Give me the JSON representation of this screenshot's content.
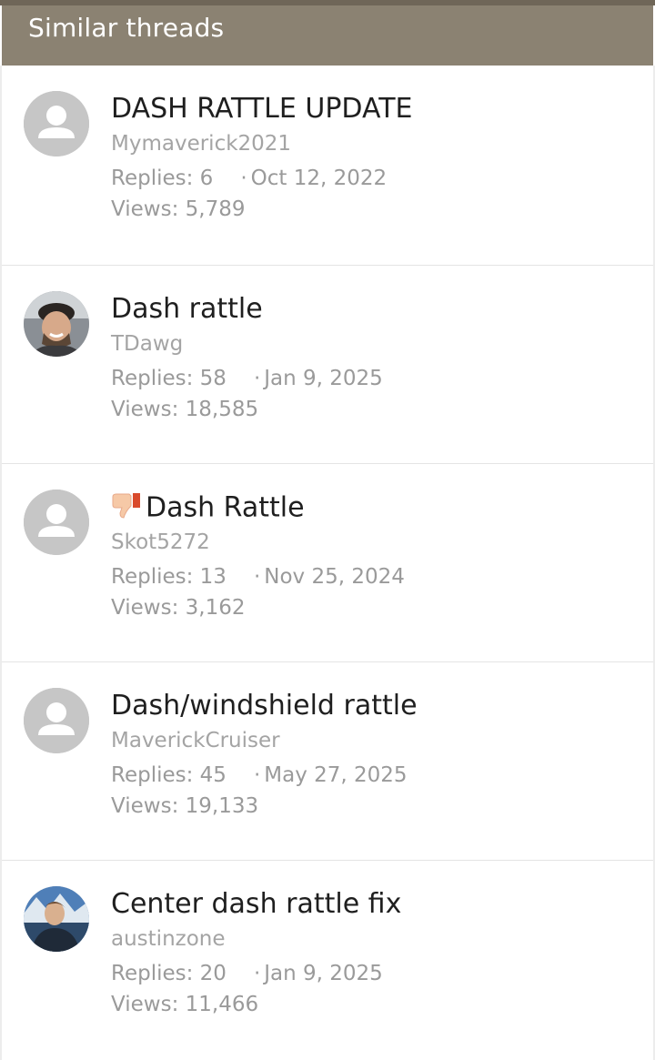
{
  "header": {
    "title": "Similar threads"
  },
  "colors": {
    "header_bg": "#8b8272",
    "title": "#1f1f1f",
    "meta": "#9a9a9a",
    "author": "#a4a4a4"
  },
  "threads": [
    {
      "title": "DASH RATTLE UPDATE",
      "author": "Mymaverick2021",
      "replies": "Replies: 6",
      "date": "Oct 12, 2022",
      "views": "Views: 5,789",
      "avatar": "default-person-icon",
      "prefix_icon": ""
    },
    {
      "title": "Dash rattle",
      "author": "TDawg",
      "replies": "Replies: 58",
      "date": "Jan 9, 2025",
      "views": "Views: 18,585",
      "avatar": "photo-man-smiling",
      "prefix_icon": ""
    },
    {
      "title": "Dash Rattle",
      "author": "Skot5272",
      "replies": "Replies: 13",
      "date": "Nov 25, 2024",
      "views": "Views: 3,162",
      "avatar": "default-person-icon",
      "prefix_icon": "thumbs-down-icon"
    },
    {
      "title": "Dash/windshield rattle",
      "author": "MaverickCruiser",
      "replies": "Replies: 45",
      "date": "May 27, 2025",
      "views": "Views: 19,133",
      "avatar": "default-person-icon",
      "prefix_icon": ""
    },
    {
      "title": "Center dash rattle fix",
      "author": "austinzone",
      "replies": "Replies: 20",
      "date": "Jan 9, 2025",
      "views": "Views: 11,466",
      "avatar": "photo-man-outdoors",
      "prefix_icon": ""
    }
  ]
}
